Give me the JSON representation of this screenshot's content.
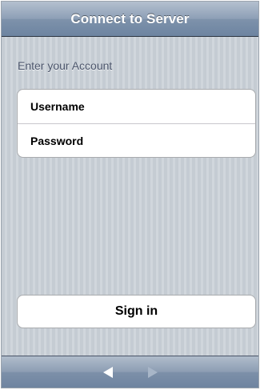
{
  "navbar": {
    "title": "Connect to Server"
  },
  "account_section": {
    "header": "Enter your Account",
    "fields": [
      {
        "label": "Username"
      },
      {
        "label": "Password"
      }
    ]
  },
  "signin": {
    "label": "Sign in"
  },
  "toolbar": {
    "back_icon": "triangle-left-icon",
    "back_enabled": true,
    "forward_icon": "triangle-right-icon",
    "forward_enabled": false
  },
  "colors": {
    "navbar_tint": "#7e92ab",
    "background_stripe": "#c5ccd3",
    "icon_enabled": "#ffffff",
    "icon_disabled": "#a8b6c8"
  }
}
